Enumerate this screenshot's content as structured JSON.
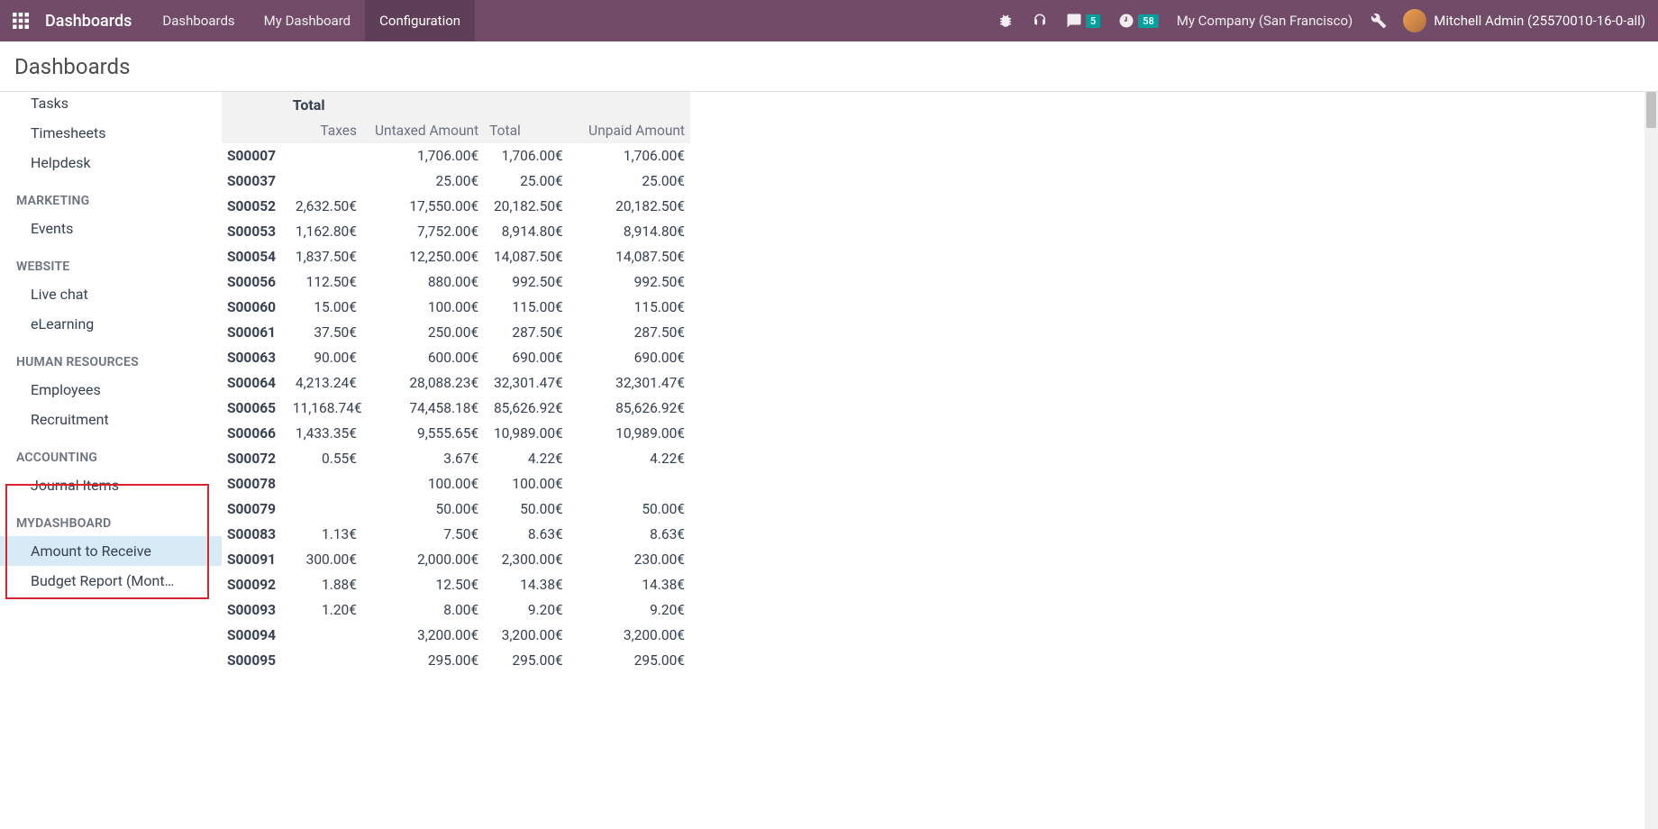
{
  "navbar": {
    "brand": "Dashboards",
    "menu": [
      {
        "label": "Dashboards",
        "active": false
      },
      {
        "label": "My Dashboard",
        "active": false
      },
      {
        "label": "Configuration",
        "active": true
      }
    ],
    "messages_badge": "5",
    "activities_badge": "58",
    "company": "My Company (San Francisco)",
    "user": "Mitchell Admin (25570010-16-0-all)"
  },
  "header": {
    "title": "Dashboards"
  },
  "sidebar": {
    "groups": [
      {
        "title": null,
        "items": [
          "Tasks",
          "Timesheets",
          "Helpdesk"
        ]
      },
      {
        "title": "MARKETING",
        "items": [
          "Events"
        ]
      },
      {
        "title": "WEBSITE",
        "items": [
          "Live chat",
          "eLearning"
        ]
      },
      {
        "title": "HUMAN RESOURCES",
        "items": [
          "Employees",
          "Recruitment"
        ]
      },
      {
        "title": "ACCOUNTING",
        "items": [
          "Journal Items"
        ]
      },
      {
        "title": "MYDASHBOARD",
        "items": [
          "Amount to Receive",
          "Budget Report (Mont…"
        ],
        "active_index": 0
      }
    ]
  },
  "table": {
    "super_header": "Total",
    "columns": [
      "Taxes",
      "Untaxed Amount",
      "Total",
      "Unpaid Amount"
    ],
    "rows": [
      {
        "id": "S00007",
        "taxes": "",
        "untaxed": "1,706.00€",
        "total": "1,706.00€",
        "unpaid": "1,706.00€"
      },
      {
        "id": "S00037",
        "taxes": "",
        "untaxed": "25.00€",
        "total": "25.00€",
        "unpaid": "25.00€"
      },
      {
        "id": "S00052",
        "taxes": "2,632.50€",
        "untaxed": "17,550.00€",
        "total": "20,182.50€",
        "unpaid": "20,182.50€"
      },
      {
        "id": "S00053",
        "taxes": "1,162.80€",
        "untaxed": "7,752.00€",
        "total": "8,914.80€",
        "unpaid": "8,914.80€"
      },
      {
        "id": "S00054",
        "taxes": "1,837.50€",
        "untaxed": "12,250.00€",
        "total": "14,087.50€",
        "unpaid": "14,087.50€"
      },
      {
        "id": "S00056",
        "taxes": "112.50€",
        "untaxed": "880.00€",
        "total": "992.50€",
        "unpaid": "992.50€"
      },
      {
        "id": "S00060",
        "taxes": "15.00€",
        "untaxed": "100.00€",
        "total": "115.00€",
        "unpaid": "115.00€"
      },
      {
        "id": "S00061",
        "taxes": "37.50€",
        "untaxed": "250.00€",
        "total": "287.50€",
        "unpaid": "287.50€"
      },
      {
        "id": "S00063",
        "taxes": "90.00€",
        "untaxed": "600.00€",
        "total": "690.00€",
        "unpaid": "690.00€"
      },
      {
        "id": "S00064",
        "taxes": "4,213.24€",
        "untaxed": "28,088.23€",
        "total": "32,301.47€",
        "unpaid": "32,301.47€"
      },
      {
        "id": "S00065",
        "taxes": "11,168.74€",
        "untaxed": "74,458.18€",
        "total": "85,626.92€",
        "unpaid": "85,626.92€"
      },
      {
        "id": "S00066",
        "taxes": "1,433.35€",
        "untaxed": "9,555.65€",
        "total": "10,989.00€",
        "unpaid": "10,989.00€"
      },
      {
        "id": "S00072",
        "taxes": "0.55€",
        "untaxed": "3.67€",
        "total": "4.22€",
        "unpaid": "4.22€"
      },
      {
        "id": "S00078",
        "taxes": "",
        "untaxed": "100.00€",
        "total": "100.00€",
        "unpaid": ""
      },
      {
        "id": "S00079",
        "taxes": "",
        "untaxed": "50.00€",
        "total": "50.00€",
        "unpaid": "50.00€"
      },
      {
        "id": "S00083",
        "taxes": "1.13€",
        "untaxed": "7.50€",
        "total": "8.63€",
        "unpaid": "8.63€"
      },
      {
        "id": "S00091",
        "taxes": "300.00€",
        "untaxed": "2,000.00€",
        "total": "2,300.00€",
        "unpaid": "230.00€"
      },
      {
        "id": "S00092",
        "taxes": "1.88€",
        "untaxed": "12.50€",
        "total": "14.38€",
        "unpaid": "14.38€"
      },
      {
        "id": "S00093",
        "taxes": "1.20€",
        "untaxed": "8.00€",
        "total": "9.20€",
        "unpaid": "9.20€"
      },
      {
        "id": "S00094",
        "taxes": "",
        "untaxed": "3,200.00€",
        "total": "3,200.00€",
        "unpaid": "3,200.00€"
      },
      {
        "id": "S00095",
        "taxes": "",
        "untaxed": "295.00€",
        "total": "295.00€",
        "unpaid": "295.00€"
      }
    ]
  }
}
